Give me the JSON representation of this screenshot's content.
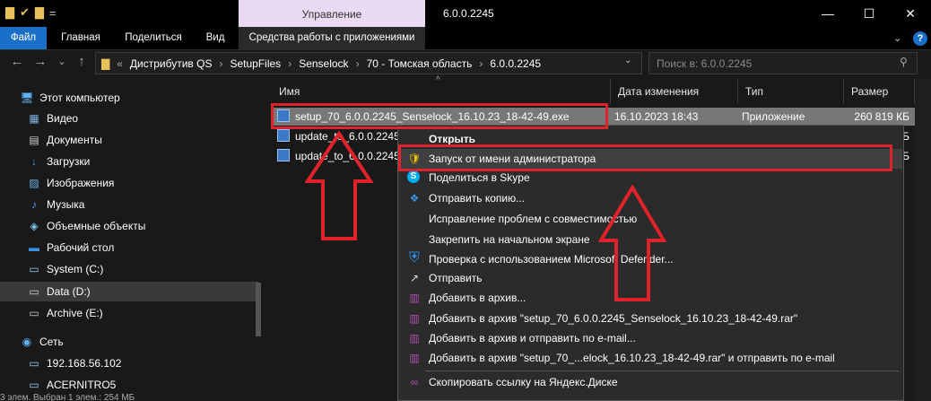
{
  "window": {
    "manage_tab": "Управление",
    "title": "6.0.0.2245",
    "minimize": "—",
    "maximize": "☐",
    "close": "✕",
    "collapse_symbol": "⌄",
    "help_symbol": "?"
  },
  "quick_access": [
    "▇",
    "✔",
    "▇",
    "="
  ],
  "ribbon": {
    "file": "Файл",
    "home": "Главная",
    "share": "Поделиться",
    "view": "Вид",
    "app_tools": "Средства работы с приложениями"
  },
  "nav_buttons": {
    "back": "←",
    "forward": "→",
    "recent": "⌄",
    "up": "↑"
  },
  "address": {
    "overflow": "«",
    "segments": [
      "Дистрибутив QS",
      "SetupFiles",
      "Senselock",
      "70 - Томская область",
      "6.0.0.2245"
    ],
    "separator": "›",
    "dropdown": "⌄"
  },
  "search": {
    "placeholder": "Поиск в: 6.0.0.2245",
    "icon": "⚲"
  },
  "nav_pane": [
    {
      "label": "Этот компьютер",
      "icon": "🖥"
    },
    {
      "label": "Видео",
      "icon": "▦"
    },
    {
      "label": "Документы",
      "icon": "▤"
    },
    {
      "label": "Загрузки",
      "icon": "↓"
    },
    {
      "label": "Изображения",
      "icon": "▨"
    },
    {
      "label": "Музыка",
      "icon": "♪"
    },
    {
      "label": "Объемные объекты",
      "icon": "◈"
    },
    {
      "label": "Рабочий стол",
      "icon": "▬"
    },
    {
      "label": "System (C:)",
      "icon": "▭"
    },
    {
      "label": "Data (D:)",
      "icon": "▭"
    },
    {
      "label": "Archive (E:)",
      "icon": "▭"
    },
    {
      "label": "Сеть",
      "icon": "◉"
    },
    {
      "label": "192.168.56.102",
      "icon": "▭"
    },
    {
      "label": "ACERNITRO5",
      "icon": "▭"
    }
  ],
  "columns": {
    "name": "Имя",
    "date": "Дата изменения",
    "type": "Тип",
    "size": "Размер",
    "sort": "^"
  },
  "files": [
    {
      "name": "setup_70_6.0.0.2245_Senselock_16.10.23_18-42-49.exe",
      "date": "16.10.2023 18:43",
      "type": "Приложение",
      "size": "260 819 КБ"
    },
    {
      "name": "update_to_6.0.0.2245",
      "date": "",
      "type": "",
      "size": "КБ"
    },
    {
      "name": "update_to_6.0.0.2245",
      "date": "",
      "type": "",
      "size": "КБ"
    }
  ],
  "context_menu": [
    {
      "label": "Открыть",
      "icon": "",
      "bold": true
    },
    {
      "label": "Запуск от имени администратора",
      "icon": "🛡"
    },
    {
      "label": "Поделиться в Skype",
      "icon": "S"
    },
    {
      "label": "Отправить копию...",
      "icon": "❖"
    },
    {
      "label": "Исправление проблем с совместимостью",
      "icon": ""
    },
    {
      "label": "Закрепить на начальном экране",
      "icon": ""
    },
    {
      "label": "Проверка с использованием Microsoft Defender...",
      "icon": "⛨"
    },
    {
      "label": "Отправить",
      "icon": "↗"
    },
    {
      "label": "Добавить в архив...",
      "icon": "▥"
    },
    {
      "label": "Добавить в архив \"setup_70_6.0.0.2245_Senselock_16.10.23_18-42-49.rar\"",
      "icon": "▥"
    },
    {
      "label": "Добавить в архив и отправить по e-mail...",
      "icon": "▥"
    },
    {
      "label": "Добавить в архив \"setup_70_...elock_16.10.23_18-42-49.rar\" и отправить по e-mail",
      "icon": "▥"
    },
    {
      "label": "Скопировать ссылку на Яндекс.Диске",
      "icon": "∞"
    }
  ],
  "status": "3 элем.   Выбран 1 элем.: 254 МБ",
  "colors": {
    "highlight": "#e0222a",
    "selected_row": "#777777",
    "file_tab": "#1a6fc9",
    "manage_tab": "#e9d9f3"
  }
}
